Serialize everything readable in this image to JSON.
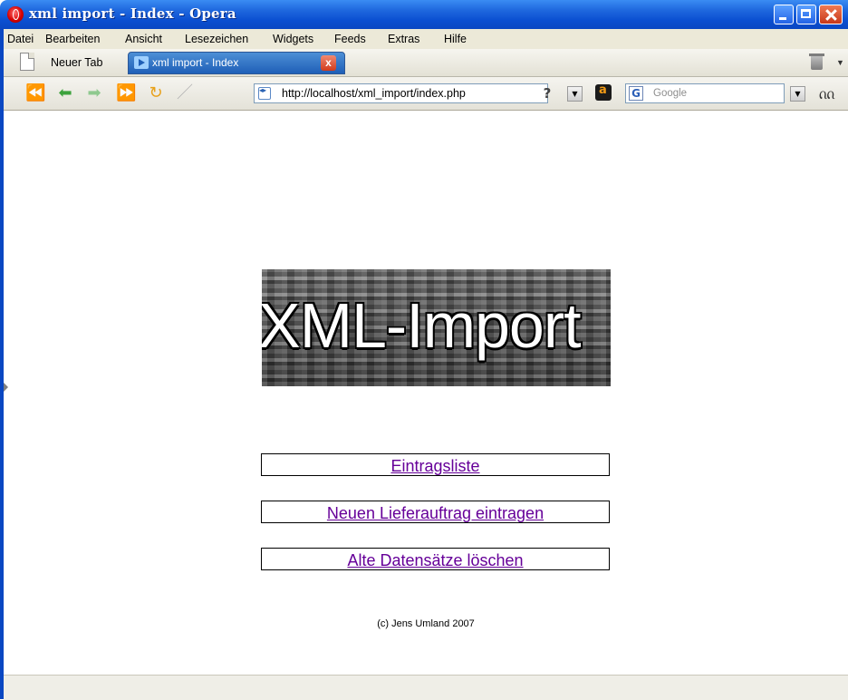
{
  "window": {
    "title": "xml import - Index - Opera"
  },
  "menu": {
    "items": [
      "Datei",
      "Bearbeiten",
      "Ansicht",
      "Lesezeichen",
      "Widgets",
      "Feeds",
      "Extras",
      "Hilfe"
    ]
  },
  "tabs": {
    "new_tab_label": "Neuer Tab",
    "active_tab_label": "xml import - Index",
    "close_glyph": "x"
  },
  "nav": {
    "url": "http://localhost/xml_import/index.php",
    "help_glyph": "?",
    "search_placeholder": "Google",
    "search_engine_glyph": "G"
  },
  "page": {
    "banner_text": "XML-Import",
    "links": [
      "Eintragsliste",
      "Neuen Lieferauftrag eintragen",
      "Alte Datensätze löschen"
    ],
    "link_color": "#660099",
    "copyright": "(c) Jens Umland 2007"
  },
  "icons": {
    "app": "opera-icon",
    "nav": [
      "rewind-icon",
      "back-icon",
      "forward-icon",
      "fast-forward-icon",
      "reload-icon",
      "edit-icon"
    ]
  }
}
